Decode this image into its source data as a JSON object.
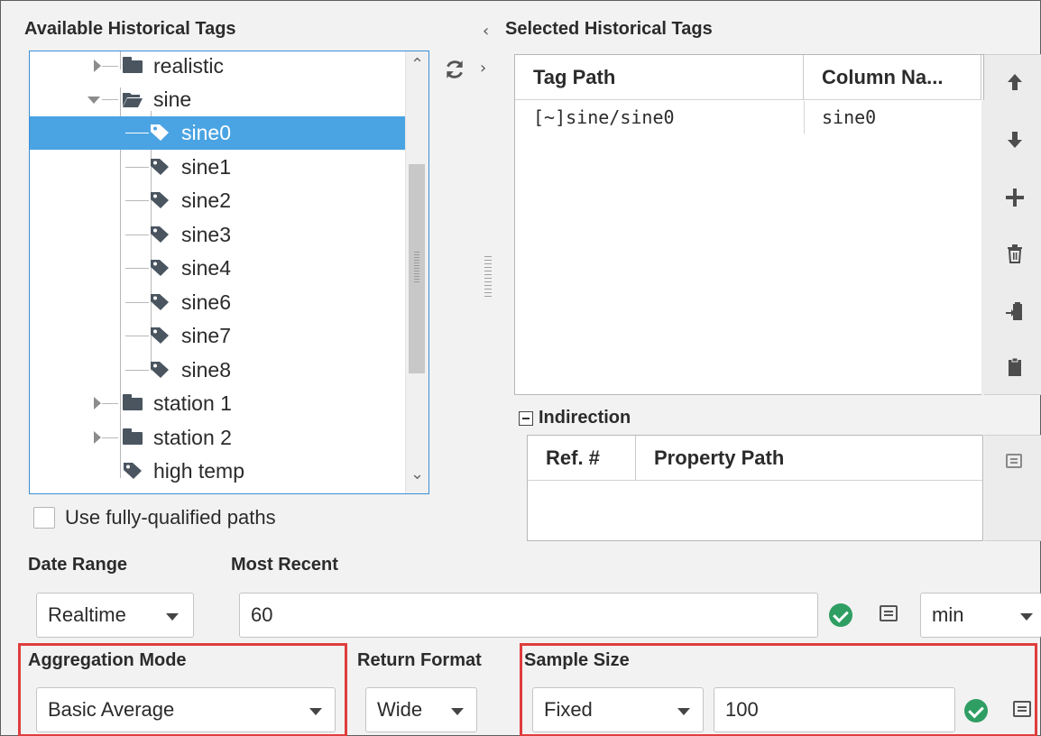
{
  "available_tags": {
    "title": "Available Historical Tags",
    "tree": [
      {
        "label": "realistic",
        "type": "folder",
        "expanded": false
      },
      {
        "label": "sine",
        "type": "folder",
        "expanded": true
      },
      {
        "label": "sine0",
        "type": "tag",
        "selected": true
      },
      {
        "label": "sine1",
        "type": "tag"
      },
      {
        "label": "sine2",
        "type": "tag"
      },
      {
        "label": "sine3",
        "type": "tag"
      },
      {
        "label": "sine4",
        "type": "tag"
      },
      {
        "label": "sine6",
        "type": "tag"
      },
      {
        "label": "sine7",
        "type": "tag"
      },
      {
        "label": "sine8",
        "type": "tag"
      },
      {
        "label": "station 1",
        "type": "folder",
        "expanded": false
      },
      {
        "label": "station 2",
        "type": "folder",
        "expanded": false
      },
      {
        "label": "high temp",
        "type": "tag"
      }
    ],
    "fully_qualified_label": "Use fully-qualified paths",
    "fully_qualified_checked": false
  },
  "selected_tags": {
    "title": "Selected Historical Tags",
    "columns": [
      "Tag Path",
      "Column Na..."
    ],
    "rows": [
      {
        "tag_path": "[~]sine/sine0",
        "column_name": "sine0"
      }
    ],
    "side_buttons": [
      "move-up-icon",
      "move-down-icon",
      "add-icon",
      "delete-icon",
      "paste-into-icon",
      "clipboard-icon"
    ]
  },
  "indirection": {
    "label": "Indirection",
    "columns": [
      "Ref. #",
      "Property Path"
    ]
  },
  "date_range": {
    "label": "Date Range",
    "value": "Realtime"
  },
  "most_recent": {
    "label": "Most Recent",
    "value": "60",
    "unit": "min"
  },
  "aggregation_mode": {
    "label": "Aggregation Mode",
    "value": "Basic Average"
  },
  "return_format": {
    "label": "Return Format",
    "value": "Wide"
  },
  "sample_size": {
    "label": "Sample Size",
    "mode": "Fixed",
    "value": "100"
  },
  "colors": {
    "selection": "#4aa3e2",
    "highlight_border": "#e03d3d",
    "ok_green": "#2f9e63"
  }
}
